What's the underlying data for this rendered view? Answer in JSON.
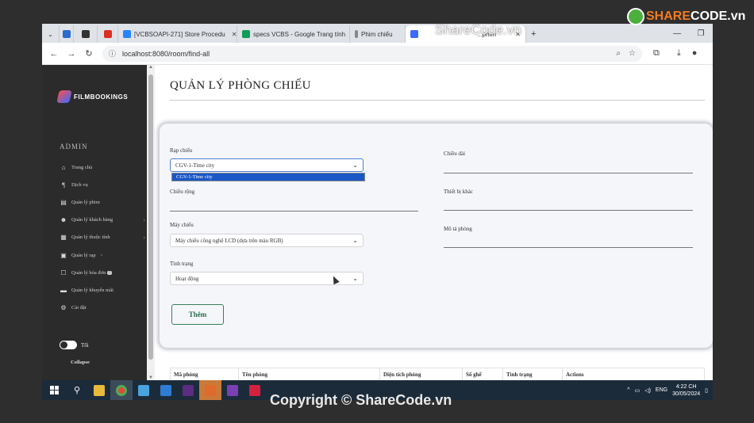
{
  "browser": {
    "tabs": [
      {
        "label": "",
        "favicon_color": "#2a6ccf",
        "active": false
      },
      {
        "label": "",
        "favicon_color": "#333333",
        "active": false
      },
      {
        "label": "",
        "favicon_color": "#d93025",
        "active": false
      },
      {
        "label": "[VCBSOAPI-271] Store Procedu",
        "favicon_color": "#2684ff",
        "active": false
      },
      {
        "label": "specs VCBS - Google Trang tính",
        "favicon_color": "#0f9d58",
        "active": false
      },
      {
        "label": "Phim chiếu",
        "favicon_color": "#888888",
        "active": false
      },
      {
        "label": "...phim",
        "favicon_color": "#3a6bff",
        "active": true
      }
    ],
    "new_tab": "+",
    "url": "localhost:8080/room/find-all"
  },
  "sidebar": {
    "logo_text": "FILMBOOKINGS",
    "section_title": "ADMIN",
    "items": [
      {
        "label": "Trang chủ",
        "icon": "home-icon",
        "chevron": false
      },
      {
        "label": "Dịch vụ",
        "icon": "food-icon",
        "chevron": false
      },
      {
        "label": "Quản lý phim",
        "icon": "film-icon",
        "chevron": false
      },
      {
        "label": "Quản lý khách hàng",
        "icon": "users-icon",
        "chevron": true
      },
      {
        "label": "Quản lý thuộc tính",
        "icon": "grid-icon",
        "chevron": true
      },
      {
        "label": "Quản lý rạp",
        "icon": "cinema-icon",
        "chevron": true
      },
      {
        "label": "Quản lý hóa đơn",
        "icon": "invoice-icon",
        "chevron": false,
        "badge": "!"
      },
      {
        "label": "Quản lý khuyến mãi",
        "icon": "ticket-icon",
        "chevron": false
      },
      {
        "label": "Cài đặt",
        "icon": "gear-icon",
        "chevron": false
      }
    ],
    "theme_label": "Tối",
    "collapse_label": "Collapse"
  },
  "page": {
    "title": "QUẢN LÝ PHÒNG CHIẾU",
    "form": {
      "rap_label": "Rạp chiếu",
      "rap_value": "CGV-1-Time city",
      "rap_option": "CGV-1-Time city",
      "chieu_rong_label": "Chiều rộng",
      "may_chieu_label": "Máy chiếu",
      "may_chieu_value": "Máy chiếu công nghệ LCD (dựa trên màu RGB)",
      "tinh_trang_label": "Tình trạng",
      "tinh_trang_value": "Hoạt động",
      "chieu_dai_label": "Chiều dài",
      "thiet_bi_label": "Thiết bị khác",
      "mo_ta_label": "Mô tả phòng",
      "add_button": "Thêm"
    },
    "table_headers": [
      "Mã phòng",
      "Tên phòng",
      "Diện tích phòng",
      "Số ghế",
      "Tình trạng",
      "Actions"
    ]
  },
  "taskbar": {
    "lang": "ENG",
    "time": "4:22 CH",
    "date": "30/05/2024"
  },
  "watermarks": {
    "top": "ShareCode.vn",
    "bottom": "Copyright © ShareCode.vn",
    "brand_a": "SHARE",
    "brand_b": "CODE.vn"
  }
}
